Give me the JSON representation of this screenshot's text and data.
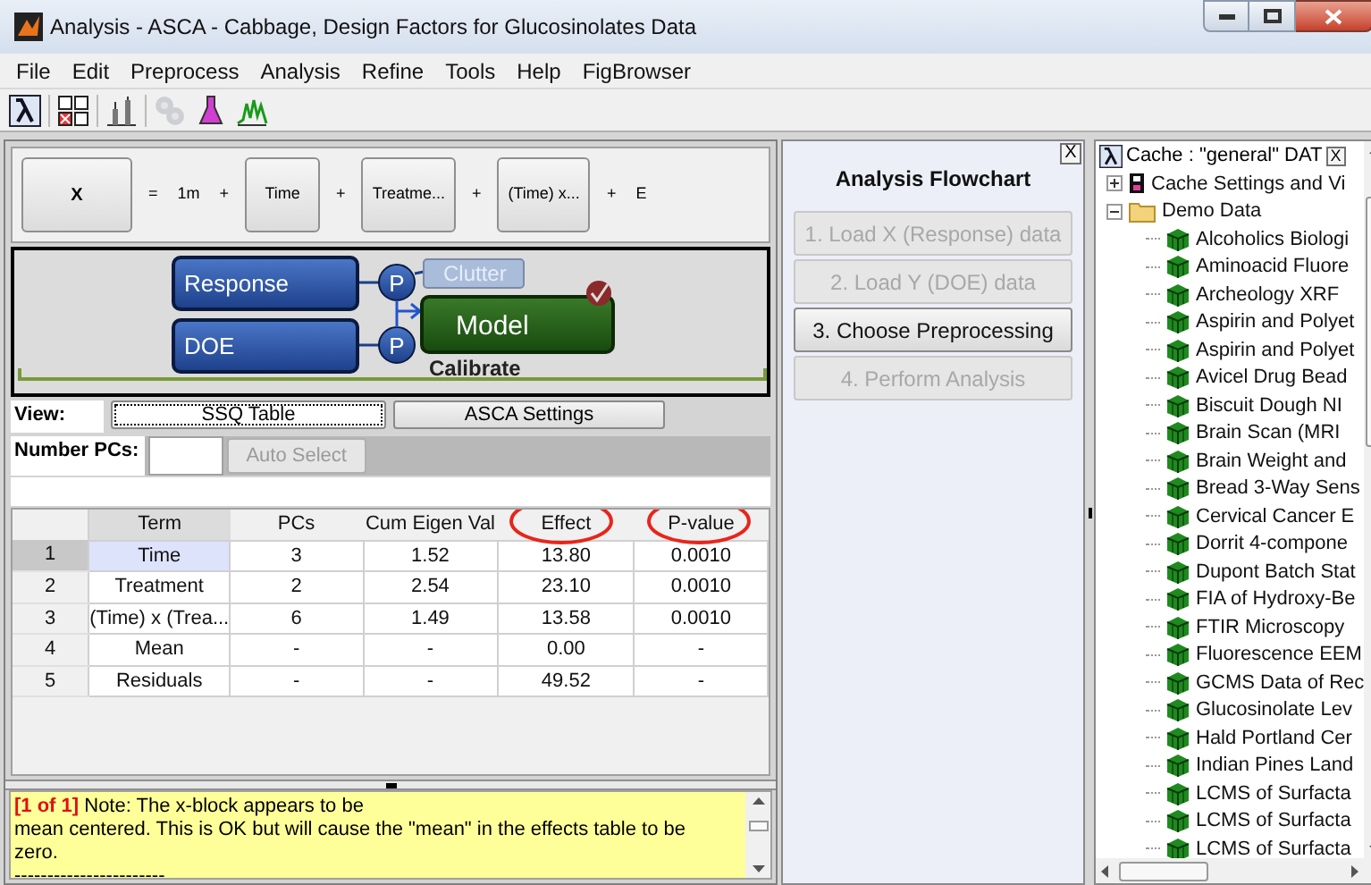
{
  "window": {
    "title": "Analysis - ASCA - Cabbage, Design Factors for Glucosinolates Data"
  },
  "menu": [
    "File",
    "Edit",
    "Preprocess",
    "Analysis",
    "Refine",
    "Tools",
    "Help",
    "FigBrowser"
  ],
  "toolbar": [
    {
      "kind": "lambda",
      "disabled": false
    },
    {
      "kind": "ab",
      "disabled": false
    },
    {
      "kind": "bars",
      "disabled": false
    },
    {
      "kind": "gear",
      "disabled": true
    },
    {
      "kind": "flask",
      "disabled": false
    },
    {
      "kind": "peaks",
      "disabled": false
    }
  ],
  "formula": [
    {
      "kind": "button",
      "text": "X",
      "bold": true
    },
    {
      "kind": "text",
      "text": "="
    },
    {
      "kind": "text",
      "text": "1m"
    },
    {
      "kind": "text",
      "text": "+"
    },
    {
      "kind": "button",
      "text": "Time",
      "bold": false
    },
    {
      "kind": "text",
      "text": "+"
    },
    {
      "kind": "button",
      "text": "Treatme...",
      "bold": false
    },
    {
      "kind": "text",
      "text": "+"
    },
    {
      "kind": "button",
      "text": "(Time) x...",
      "bold": false
    },
    {
      "kind": "text",
      "text": "+"
    },
    {
      "kind": "text",
      "text": "E"
    }
  ],
  "diagram": {
    "inputs": [
      {
        "label": "Response",
        "marker": "P"
      },
      {
        "label": "DOE",
        "marker": "P"
      }
    ],
    "clutter": {
      "label": "Clutter",
      "disabled": true
    },
    "model": {
      "label": "Model",
      "checked": true
    },
    "caption": "Calibrate"
  },
  "view": {
    "label": "View:",
    "tabs": [
      {
        "label": "SSQ Table",
        "selected": true
      },
      {
        "label": "ASCA Settings",
        "selected": false
      }
    ]
  },
  "pcs": {
    "label": "Number PCs:",
    "button": {
      "label": "Auto Select",
      "disabled": true
    }
  },
  "table": {
    "columns": [
      {
        "label": "Term",
        "circled": false
      },
      {
        "label": "PCs",
        "circled": false
      },
      {
        "label": "Cum Eigen Val",
        "circled": false
      },
      {
        "label": "Effect",
        "circled": true
      },
      {
        "label": "P-value",
        "circled": true
      }
    ],
    "rows": [
      {
        "index": "1",
        "selected": true,
        "cells": [
          "Time",
          "3",
          "1.52",
          "13.80",
          "0.0010"
        ]
      },
      {
        "index": "2",
        "selected": false,
        "cells": [
          "Treatment",
          "2",
          "2.54",
          "23.10",
          "0.0010"
        ]
      },
      {
        "index": "3",
        "selected": false,
        "cells": [
          "(Time) x (Trea...",
          "6",
          "1.49",
          "13.58",
          "0.0010"
        ]
      },
      {
        "index": "4",
        "selected": false,
        "cells": [
          "Mean",
          "-",
          "-",
          "0.00",
          "-"
        ]
      },
      {
        "index": "5",
        "selected": false,
        "cells": [
          "Residuals",
          "-",
          "-",
          "49.52",
          "-"
        ]
      }
    ]
  },
  "note": {
    "counter": "[1 of 1]",
    "lines": [
      "Note: The x-block appears to be",
      "mean centered. This is OK but will cause the \"mean\" in the effects table to be",
      "zero.",
      "-----------------------"
    ]
  },
  "flowchart": {
    "title": "Analysis Flowchart",
    "close": "X",
    "steps": [
      {
        "label": "1. Load X (Response) data",
        "disabled": true
      },
      {
        "label": "2. Load Y (DOE) data",
        "disabled": true
      },
      {
        "label": "3. Choose Preprocessing",
        "disabled": false
      },
      {
        "label": "4. Perform Analysis",
        "disabled": true
      }
    ]
  },
  "cache": {
    "title": "Cache : \"general\" DAT",
    "close": "X",
    "nodes": [
      {
        "kind": "settings",
        "label": "Cache Settings and Vi",
        "expanded": false
      },
      {
        "kind": "folder",
        "label": "Demo Data",
        "expanded": true,
        "children": [
          {
            "kind": "dataset",
            "label": "Alcoholics Biologi"
          },
          {
            "kind": "dataset",
            "label": "Aminoacid Fluore"
          },
          {
            "kind": "dataset",
            "label": "Archeology XRF"
          },
          {
            "kind": "dataset",
            "label": "Aspirin and Polyet"
          },
          {
            "kind": "dataset",
            "label": "Aspirin and Polyet"
          },
          {
            "kind": "dataset",
            "label": "Avicel Drug Bead"
          },
          {
            "kind": "dataset",
            "label": "Biscuit Dough NI"
          },
          {
            "kind": "dataset",
            "label": "Brain Scan (MRI"
          },
          {
            "kind": "dataset",
            "label": "Brain Weight and"
          },
          {
            "kind": "dataset",
            "label": "Bread 3-Way Sens"
          },
          {
            "kind": "dataset",
            "label": "Cervical Cancer E"
          },
          {
            "kind": "dataset",
            "label": "Dorrit 4-compone"
          },
          {
            "kind": "dataset",
            "label": "Dupont Batch Stat"
          },
          {
            "kind": "dataset",
            "label": "FIA of Hydroxy-Be"
          },
          {
            "kind": "dataset",
            "label": "FTIR Microscopy"
          },
          {
            "kind": "dataset",
            "label": "Fluorescence EEM"
          },
          {
            "kind": "dataset",
            "label": "GCMS Data of Rec"
          },
          {
            "kind": "dataset",
            "label": "Glucosinolate Lev"
          },
          {
            "kind": "dataset",
            "label": "Hald Portland Cer"
          },
          {
            "kind": "dataset",
            "label": "Indian Pines Land"
          },
          {
            "kind": "dataset",
            "label": "LCMS of Surfacta"
          },
          {
            "kind": "dataset",
            "label": "LCMS of Surfacta"
          },
          {
            "kind": "dataset",
            "label": "LCMS of Surfacta"
          }
        ]
      }
    ]
  }
}
